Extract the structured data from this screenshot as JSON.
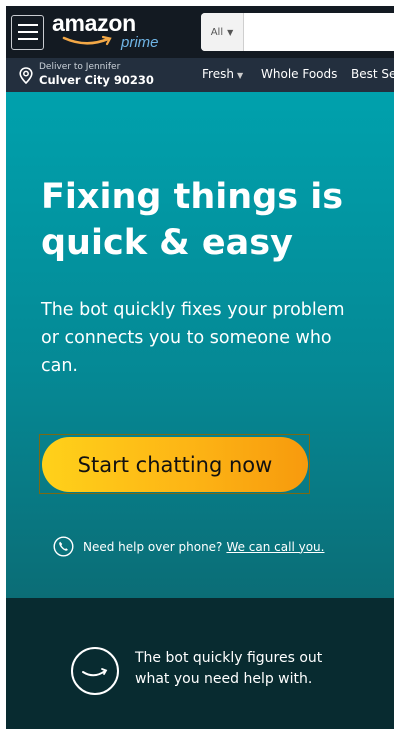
{
  "header": {
    "logo_word": "amazon",
    "logo_sub": "prime",
    "search": {
      "category_label": "All",
      "placeholder": ""
    }
  },
  "subnav": {
    "deliver_to": "Deliver to Jennifer",
    "location": "Culver City 90230",
    "items": [
      "Fresh",
      "Whole Foods",
      "Best Sel"
    ]
  },
  "hero": {
    "title_line1": "Fixing things is",
    "title_line2": "quick & easy",
    "subtitle": "The bot quickly fixes your problem or connects you to someone who can.",
    "cta_label": "Start chatting now",
    "phone_prompt": "Need help over phone?",
    "phone_link": "We can call you."
  },
  "feature": {
    "text_line1": "The bot quickly figures out",
    "text_line2": "what you need help with."
  },
  "colors": {
    "header_bg": "#131a22",
    "subnav_bg": "#232f3e",
    "hero_teal": "#00a1ad",
    "cta_yellow": "#ffd11a",
    "feature_bg": "#082b30",
    "prime_blue": "#6fb4e5",
    "smile_orange": "#f3a847"
  },
  "icons": {
    "menu": "hamburger-menu-icon",
    "location": "location-pin-icon",
    "phone": "phone-icon",
    "feature": "smile-circle-icon"
  }
}
